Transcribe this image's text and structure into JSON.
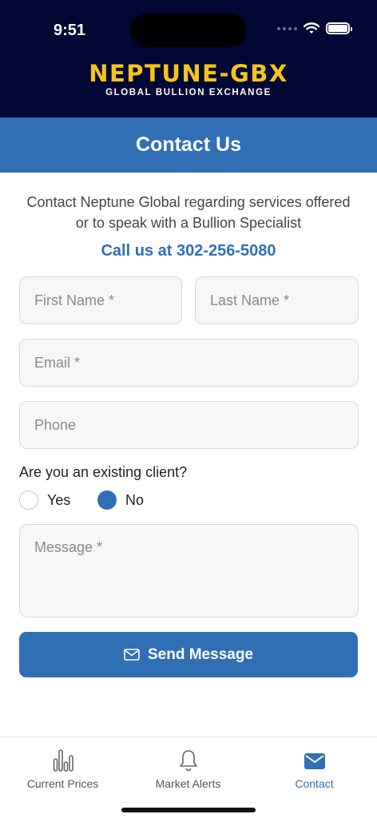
{
  "status_bar": {
    "time": "9:51"
  },
  "brand": {
    "name": "NEPTUNE-GBX",
    "tagline": "GLOBAL BULLION EXCHANGE",
    "accent": "#f5c518",
    "background": "#020733"
  },
  "header": {
    "title": "Contact Us",
    "color": "#316fb4"
  },
  "intro": {
    "text": "Contact Neptune Global regarding services offered or to speak with a Bullion Specialist",
    "call": "Call us at 302-256-5080"
  },
  "form": {
    "first_name": {
      "placeholder": "First Name *",
      "value": ""
    },
    "last_name": {
      "placeholder": "Last Name *",
      "value": ""
    },
    "email": {
      "placeholder": "Email *",
      "value": ""
    },
    "phone": {
      "placeholder": "Phone",
      "value": ""
    },
    "existing_client": {
      "question": "Are you an existing client?",
      "options": [
        "Yes",
        "No"
      ],
      "selected": "No"
    },
    "message": {
      "placeholder": "Message *",
      "value": ""
    },
    "submit": {
      "label": "Send Message",
      "icon": "envelope-icon"
    }
  },
  "tabbar": {
    "items": [
      {
        "label": "Current Prices",
        "icon": "bar-chart-icon",
        "active": false
      },
      {
        "label": "Market Alerts",
        "icon": "bell-icon",
        "active": false
      },
      {
        "label": "Contact",
        "icon": "envelope-icon",
        "active": true
      }
    ]
  }
}
